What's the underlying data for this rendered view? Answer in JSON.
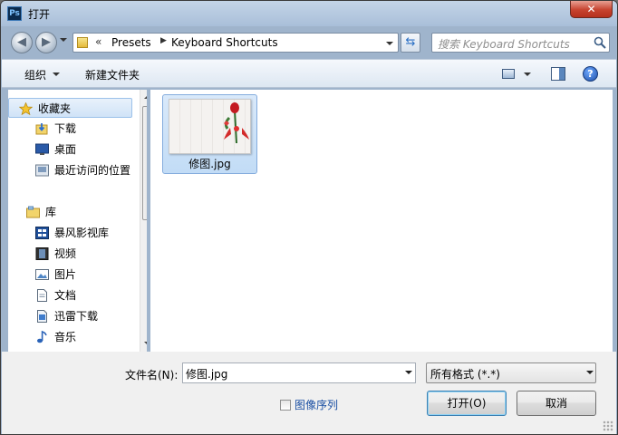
{
  "window": {
    "title": "打开",
    "app_icon_text": "Ps",
    "close_glyph": "✕"
  },
  "address": {
    "overflow": "«",
    "segments": [
      "Presets",
      "Keyboard Shortcuts"
    ],
    "separator": "▶"
  },
  "search": {
    "placeholder": "搜索 Keyboard Shortcuts"
  },
  "toolbar": {
    "organize_label": "组织",
    "new_folder_label": "新建文件夹",
    "help_glyph": "?"
  },
  "sidebar": {
    "favorites_label": "收藏夹",
    "favorites": [
      {
        "label": "下载",
        "icon": "download-folder-icon"
      },
      {
        "label": "桌面",
        "icon": "desktop-icon"
      },
      {
        "label": "最近访问的位置",
        "icon": "recent-places-icon"
      }
    ],
    "libraries_label": "库",
    "libraries": [
      {
        "label": "暴风影视库",
        "icon": "video-library-icon"
      },
      {
        "label": "视频",
        "icon": "video-icon"
      },
      {
        "label": "图片",
        "icon": "pictures-icon"
      },
      {
        "label": "文档",
        "icon": "documents-icon"
      },
      {
        "label": "迅雷下载",
        "icon": "thunder-download-icon"
      },
      {
        "label": "音乐",
        "icon": "music-icon"
      }
    ]
  },
  "files": [
    {
      "name": "修图.jpg",
      "selected": true
    }
  ],
  "bottom": {
    "filename_label": "文件名(N):",
    "filename_value": "修图.jpg",
    "filetype_value": "所有格式 (*.*)",
    "sequence_label": "图像序列",
    "sequence_checked": false,
    "open_label": "打开(O)",
    "cancel_label": "取消"
  },
  "colors": {
    "selection": "#cce4f7",
    "link": "#1a4fa3",
    "frame": "#9fb4cc"
  }
}
